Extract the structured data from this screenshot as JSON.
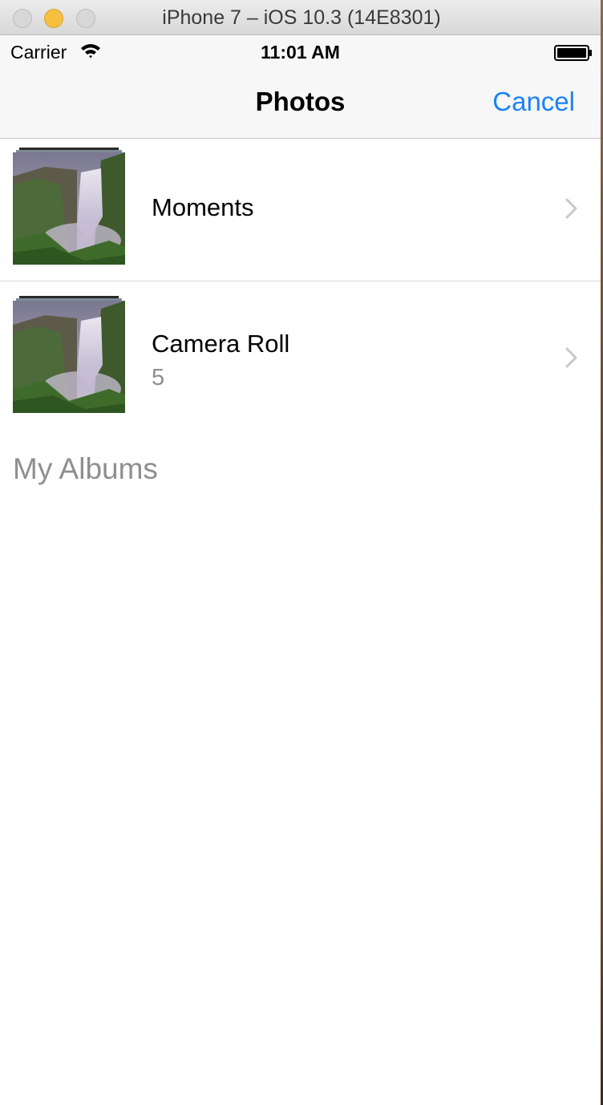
{
  "window": {
    "title": "iPhone 7 – iOS 10.3 (14E8301)"
  },
  "status_bar": {
    "carrier": "Carrier",
    "time": "11:01 AM",
    "icons": [
      "wifi-icon",
      "battery-icon"
    ]
  },
  "nav_bar": {
    "title": "Photos",
    "cancel_label": "Cancel",
    "accent_color": "#1a82fb"
  },
  "albums": [
    {
      "label": "Moments",
      "count": ""
    },
    {
      "label": "Camera Roll",
      "count": "5"
    }
  ],
  "section_header": "My Albums"
}
